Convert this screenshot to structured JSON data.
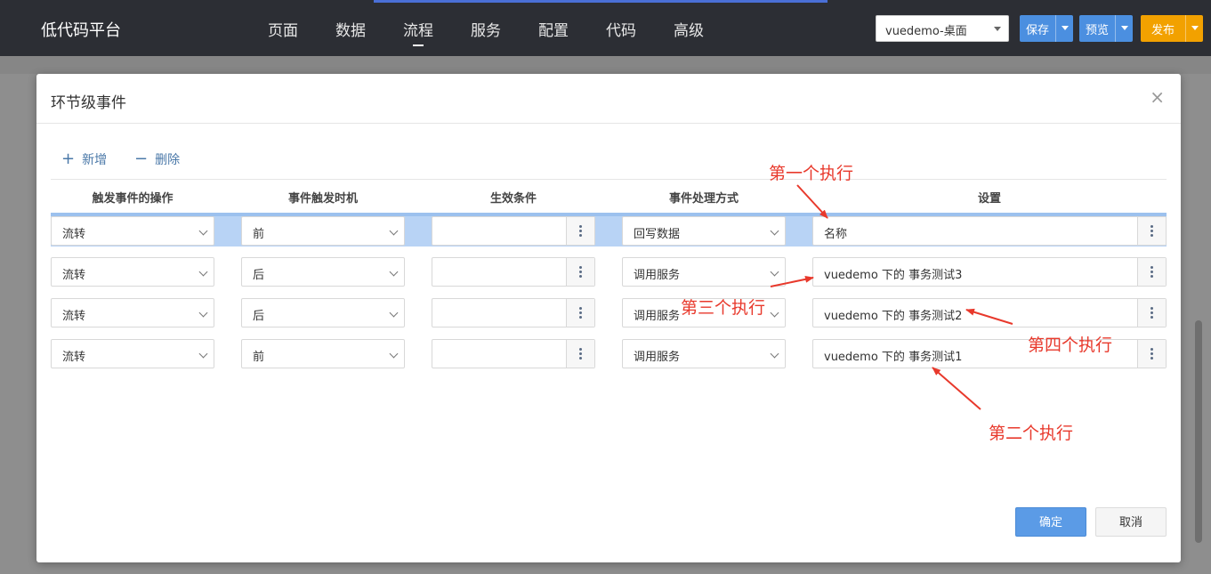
{
  "topbar": {
    "brand": "低代码平台",
    "nav": [
      "页面",
      "数据",
      "流程",
      "服务",
      "配置",
      "代码",
      "高级"
    ],
    "active_nav": "流程",
    "app_select": "vuedemo-桌面",
    "save_label": "保存",
    "preview_label": "预览",
    "publish_label": "发布"
  },
  "modal": {
    "title": "环节级事件",
    "close_glyph": "×",
    "add_label": "新增",
    "delete_label": "删除",
    "columns": [
      "触发事件的操作",
      "事件触发时机",
      "生效条件",
      "事件处理方式",
      "设置"
    ],
    "rows": [
      {
        "operation": "流转",
        "timing": "前",
        "condition": "",
        "method": "回写数据",
        "setting": "名称",
        "selected": true
      },
      {
        "operation": "流转",
        "timing": "后",
        "condition": "",
        "method": "调用服务",
        "setting": "vuedemo 下的 事务测试3",
        "selected": false
      },
      {
        "operation": "流转",
        "timing": "后",
        "condition": "",
        "method": "调用服务",
        "setting": "vuedemo 下的 事务测试2",
        "selected": false
      },
      {
        "operation": "流转",
        "timing": "前",
        "condition": "",
        "method": "调用服务",
        "setting": "vuedemo 下的 事务测试1",
        "selected": false
      }
    ],
    "ok_label": "确定",
    "cancel_label": "取消"
  },
  "annotations": {
    "first": "第一个执行",
    "second": "第二个执行",
    "third": "第三个执行",
    "fourth": "第四个执行",
    "color": "#e8392c"
  },
  "colors": {
    "topbar": "#2c2e34",
    "primary": "#4b8fe0",
    "publish": "#f2a100",
    "selected_row": "#b8d3f5"
  }
}
